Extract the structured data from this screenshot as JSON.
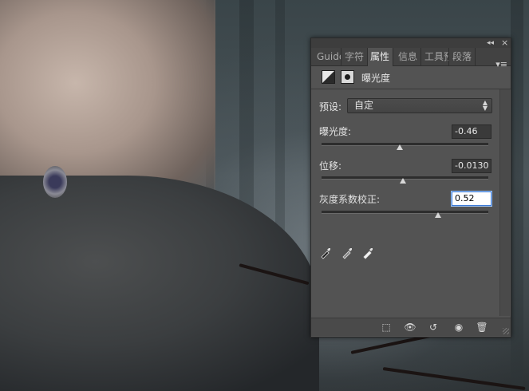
{
  "panel": {
    "collapse_glyph": "◂◂",
    "close_glyph": "×",
    "menu_glyph": "▾≡",
    "tabs": [
      {
        "label": "Guide",
        "active": false
      },
      {
        "label": "字符",
        "active": false
      },
      {
        "label": "属性",
        "active": true
      },
      {
        "label": "信息",
        "active": false
      },
      {
        "label": "工具预",
        "active": false
      },
      {
        "label": "段落",
        "active": false
      }
    ],
    "header": {
      "title": "曝光度",
      "icons": [
        "exposure-adjustment-icon",
        "layer-mask-icon"
      ]
    },
    "preset": {
      "label": "预设:",
      "value": "自定"
    },
    "controls": [
      {
        "label": "曝光度:",
        "value": "-0.46",
        "slider_fraction": 0.47
      },
      {
        "label": "位移:",
        "value": "-0.0130",
        "slider_fraction": 0.49
      },
      {
        "label": "灰度系数校正:",
        "value": "0.52",
        "slider_fraction": 0.7,
        "focused": true
      }
    ],
    "eyedroppers": [
      "black-point-eyedropper-icon",
      "gray-point-eyedropper-icon",
      "white-point-eyedropper-icon"
    ],
    "footer_buttons": [
      {
        "name": "clip-to-layer-button",
        "glyph": "⬚"
      },
      {
        "name": "view-previous-state-button",
        "glyph": "👁"
      },
      {
        "name": "reset-button",
        "glyph": "↺"
      },
      {
        "name": "toggle-visibility-button",
        "glyph": "◉"
      },
      {
        "name": "delete-button",
        "glyph": "🗑"
      }
    ]
  },
  "colors": {
    "panel_bg": "#535353",
    "tab_bar_bg": "#424242",
    "focus_border": "#3d7bd6"
  }
}
